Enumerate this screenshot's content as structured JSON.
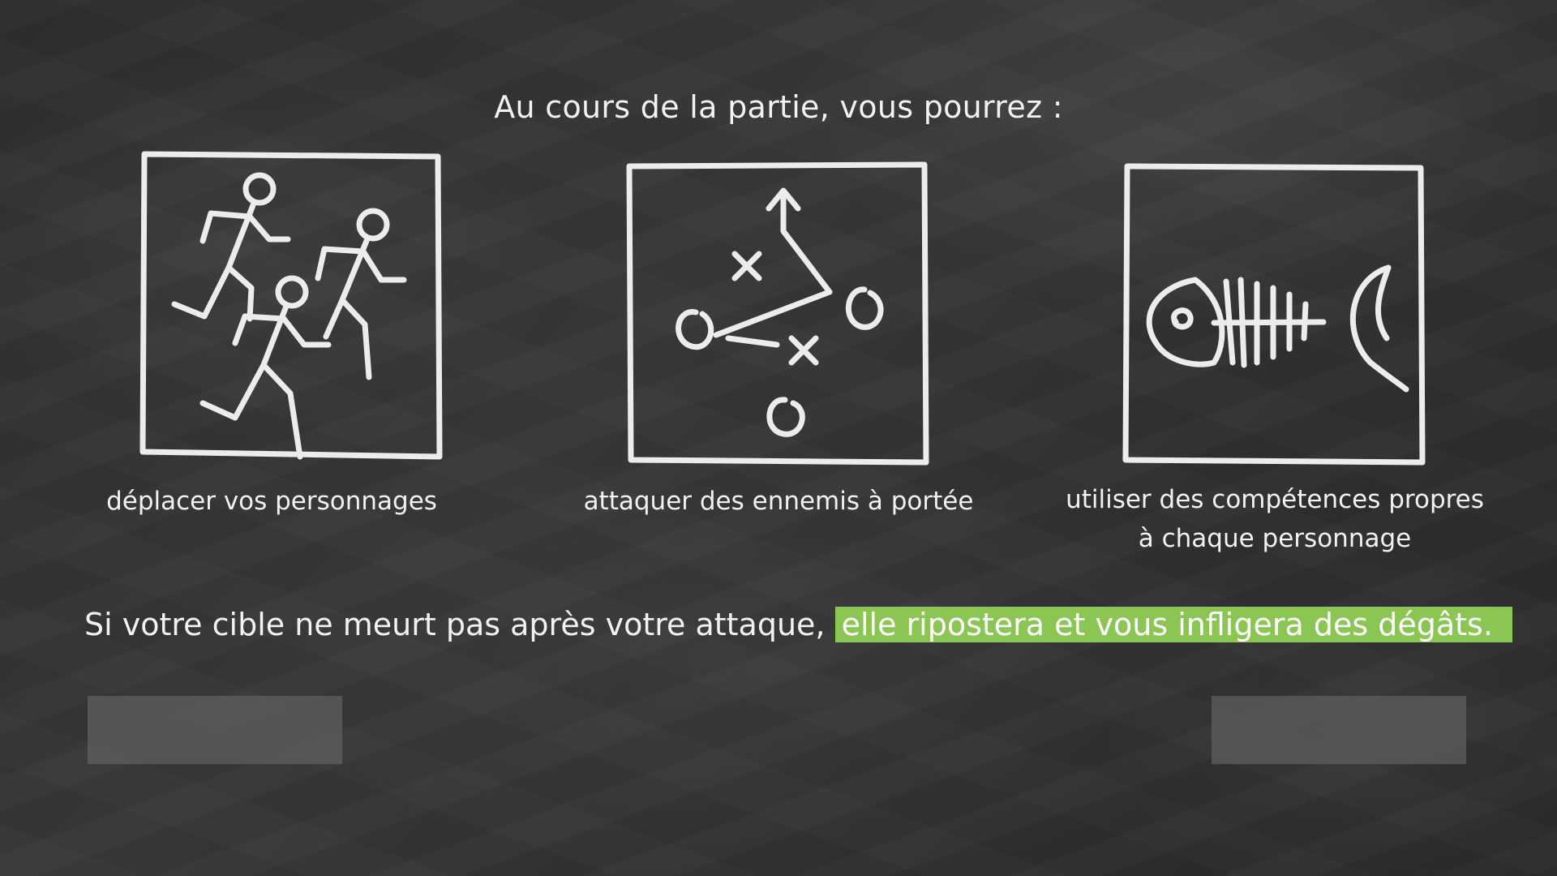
{
  "heading": "Au cours de la partie, vous pourrez :",
  "actions": [
    {
      "caption": "déplacer vos personnages",
      "icon": "running-figures-icon"
    },
    {
      "caption": "attaquer des ennemis à portée",
      "icon": "tactics-play-icon"
    },
    {
      "caption_lines": [
        "utiliser des compétences propres",
        "à chaque personnage"
      ],
      "icon": "fish-skeleton-icon"
    }
  ],
  "rule": {
    "text": "Si votre cible ne meurt pas après votre attaque, ",
    "highlight": "elle ripostera et vous infligera des dégâts."
  },
  "colors": {
    "highlight": "#8bc554",
    "chalk": "#f2f2f2",
    "board": "#333333"
  }
}
